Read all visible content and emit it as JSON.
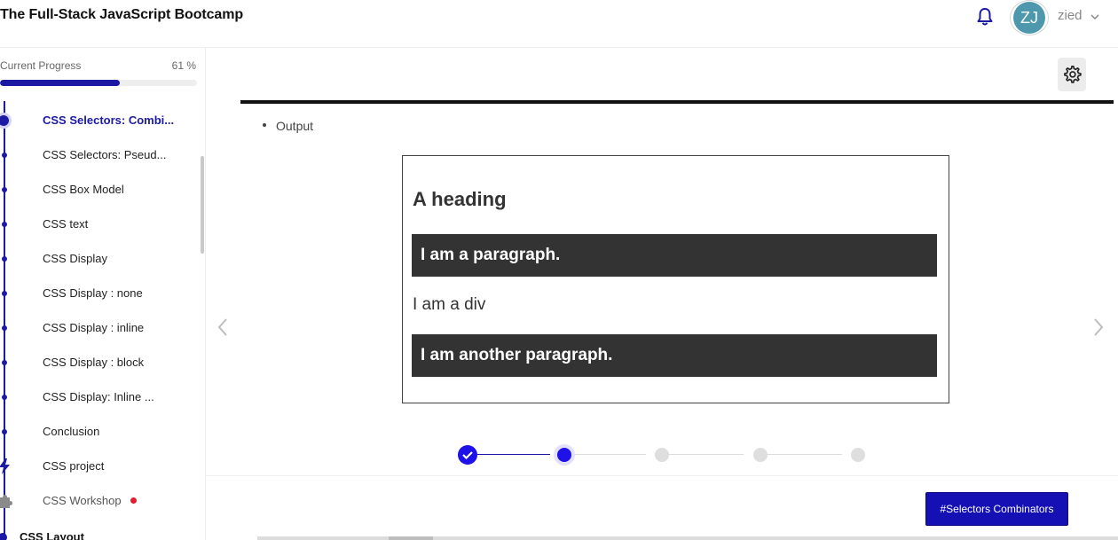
{
  "header": {
    "course_title": "The Full-Stack JavaScript Bootcamp",
    "avatar_initials": "ZJ",
    "username": "zied",
    "icons": [
      "bell-icon",
      "chevron-down-icon"
    ]
  },
  "sidebar": {
    "progress_label": "Current Progress",
    "progress_percent_text": "61 %",
    "progress_value": 0.61,
    "lessons": [
      {
        "label": "CSS Selectors: Combi...",
        "state": "active"
      },
      {
        "label": "CSS Selectors: Pseud...",
        "state": "normal"
      },
      {
        "label": "CSS Box Model",
        "state": "normal"
      },
      {
        "label": "CSS text",
        "state": "normal"
      },
      {
        "label": "CSS Display",
        "state": "normal"
      },
      {
        "label": "CSS Display : none",
        "state": "normal"
      },
      {
        "label": "CSS Display : inline",
        "state": "normal"
      },
      {
        "label": "CSS Display : block",
        "state": "normal"
      },
      {
        "label": "CSS Display: Inline ...",
        "state": "normal"
      },
      {
        "label": "Conclusion",
        "state": "normal"
      },
      {
        "label": "CSS project",
        "state": "project"
      },
      {
        "label": "CSS Workshop",
        "state": "workshop"
      }
    ],
    "next_section": "CSS Layout"
  },
  "main": {
    "output_label": "Output",
    "demo": {
      "heading": "A heading",
      "paragraph_1": "I am a paragraph.",
      "div_text": "I am a div",
      "paragraph_2": "I am another paragraph."
    },
    "stepper": {
      "total_steps": 5,
      "completed_steps": 1,
      "current_step": 2
    },
    "next_button_label": "#Selectors Combinators",
    "colors": {
      "accent": "#1c1aa3",
      "button": "#1410b4",
      "notification": "#e01e2e"
    }
  }
}
